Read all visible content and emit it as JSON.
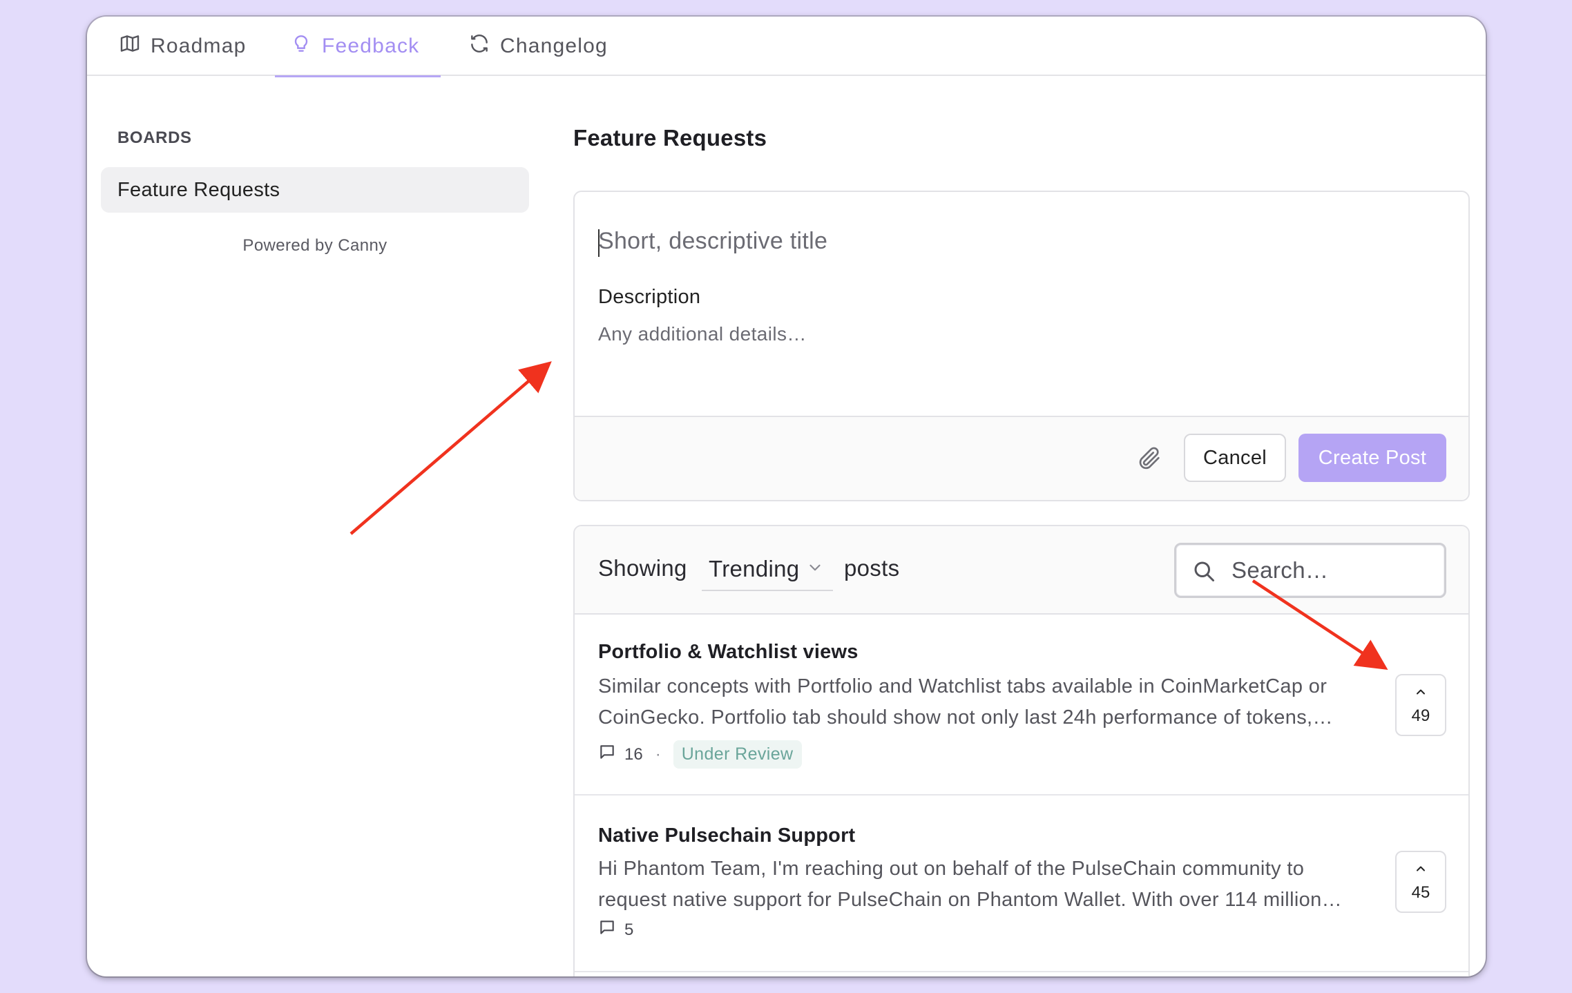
{
  "nav": {
    "tabs": [
      {
        "label": "Roadmap",
        "icon": "map-icon"
      },
      {
        "label": "Feedback",
        "icon": "lightbulb-icon",
        "active": true
      },
      {
        "label": "Changelog",
        "icon": "refresh-icon"
      }
    ]
  },
  "sidebar": {
    "title": "BOARDS",
    "boards": [
      {
        "label": "Feature Requests",
        "selected": true
      }
    ],
    "powered_by": "Powered by Canny"
  },
  "main": {
    "title": "Feature Requests",
    "form": {
      "title_placeholder": "Short, descriptive title",
      "description_label": "Description",
      "description_placeholder": "Any additional details…",
      "attach_icon": "paperclip-icon",
      "cancel_label": "Cancel",
      "create_label": "Create Post"
    },
    "posts_header": {
      "showing": "Showing",
      "sort_value": "Trending",
      "posts_word": "posts",
      "search_placeholder": "Search…"
    },
    "posts": [
      {
        "title": "Portfolio & Watchlist views",
        "body_line1": "Similar concepts with Portfolio and Watchlist tabs available in CoinMarketCap or",
        "body_line2": "CoinGecko. Portfolio tab should show not only last 24h performance of tokens,…",
        "comments": "16",
        "status": "Under Review",
        "votes": "49"
      },
      {
        "title": "Native Pulsechain Support",
        "body_line1": "Hi Phantom Team, I'm reaching out on behalf of the PulseChain community to",
        "body_line2": "request native support for PulseChain on Phantom Wallet. With over 114 million…",
        "comments": "5",
        "votes": "45"
      }
    ]
  },
  "colors": {
    "accent": "#a38ef2",
    "create_button": "#b5a4f4",
    "background": "#e3dcfb",
    "annotation_arrow": "#f0321e",
    "status_under_review": "#6aa59a"
  }
}
